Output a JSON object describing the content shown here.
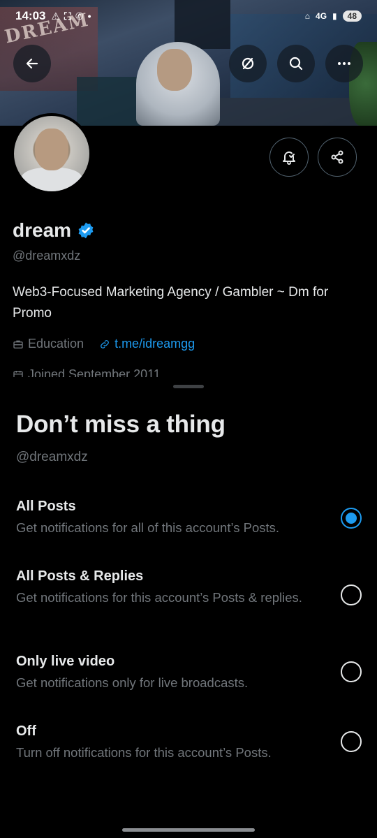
{
  "status_bar": {
    "time": "14:03",
    "network": "4G",
    "battery": "48"
  },
  "banner": {
    "text": "DREAM"
  },
  "profile": {
    "name": "dream",
    "handle": "@dreamxdz",
    "bio": "Web3-Focused Marketing Agency / Gambler ~ Dm for Promo",
    "category": "Education",
    "link": "t.me/idreamgg",
    "joined": "Joined September 2011"
  },
  "icons": {
    "back": "arrow-left-icon",
    "no_interest": "circle-slash-icon",
    "search": "search-icon",
    "more": "more-horizontal-icon",
    "notifications": "bell-check-icon",
    "share": "share-icon",
    "verified": "verified-badge-icon"
  },
  "colors": {
    "accent": "#1d9bf0",
    "background": "#000000",
    "text_primary": "#e7e9ea",
    "text_secondary": "#71767b"
  },
  "sheet": {
    "title": "Don’t miss a thing",
    "handle": "@dreamxdz",
    "options": [
      {
        "title": "All Posts",
        "description": "Get notifications for all of this account’s Posts.",
        "selected": true
      },
      {
        "title": "All Posts & Replies",
        "description": "Get notifications for this account’s Posts & replies.",
        "selected": false
      },
      {
        "title": "Only live video",
        "description": "Get notifications only for live broadcasts.",
        "selected": false
      },
      {
        "title": "Off",
        "description": "Turn off notifications for this account’s Posts.",
        "selected": false
      }
    ]
  }
}
